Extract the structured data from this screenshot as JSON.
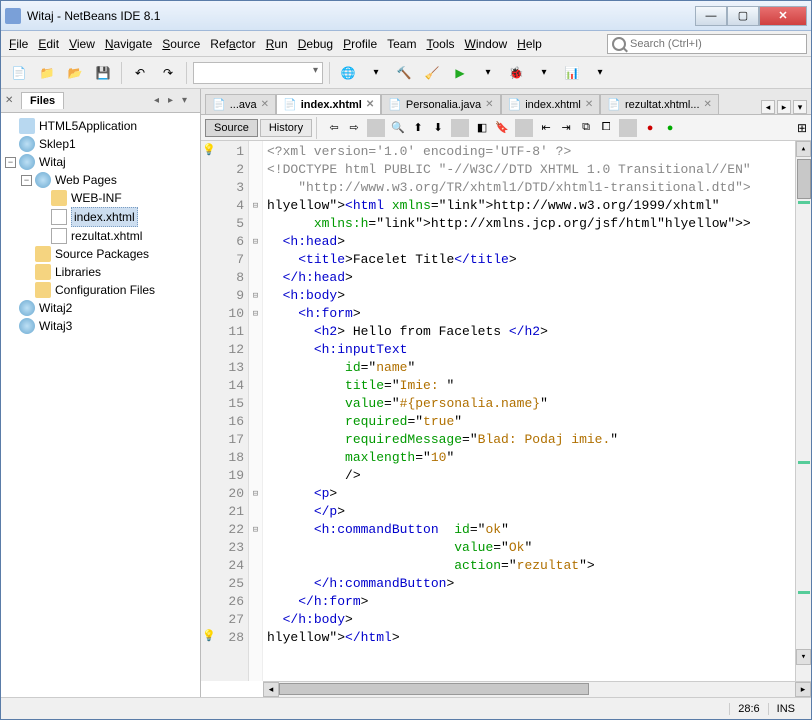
{
  "window": {
    "title": "Witaj - NetBeans IDE 8.1"
  },
  "menu": [
    "File",
    "Edit",
    "View",
    "Navigate",
    "Source",
    "Refactor",
    "Run",
    "Debug",
    "Profile",
    "Team",
    "Tools",
    "Window",
    "Help"
  ],
  "menuMnemonic": [
    "F",
    "E",
    "V",
    "N",
    "S",
    "a",
    "R",
    "D",
    "P",
    "",
    "T",
    "W",
    "H"
  ],
  "search": {
    "placeholder": "Search (Ctrl+I)"
  },
  "filesTabLabel": "Files",
  "projects": [
    {
      "name": "HTML5Application",
      "open": false,
      "icon": "proj"
    },
    {
      "name": "Sklep1",
      "open": false,
      "icon": "globe"
    },
    {
      "name": "Witaj",
      "open": true,
      "icon": "globe",
      "children": [
        {
          "name": "Web Pages",
          "open": true,
          "icon": "globe",
          "children": [
            {
              "name": "WEB-INF",
              "open": false,
              "icon": "folder"
            },
            {
              "name": "index.xhtml",
              "open": false,
              "icon": "file",
              "selected": true
            },
            {
              "name": "rezultat.xhtml",
              "open": false,
              "icon": "file"
            }
          ]
        },
        {
          "name": "Source Packages",
          "open": false,
          "icon": "folder"
        },
        {
          "name": "Libraries",
          "open": false,
          "icon": "folder"
        },
        {
          "name": "Configuration Files",
          "open": false,
          "icon": "folder"
        }
      ]
    },
    {
      "name": "Witaj2",
      "open": false,
      "icon": "globe"
    },
    {
      "name": "Witaj3",
      "open": false,
      "icon": "globe"
    }
  ],
  "editorTabs": [
    {
      "label": "...ava",
      "active": false
    },
    {
      "label": "index.xhtml",
      "active": true
    },
    {
      "label": "Personalia.java",
      "active": false
    },
    {
      "label": "index.xhtml",
      "active": false
    },
    {
      "label": "rezultat.xhtml...",
      "active": false
    }
  ],
  "sourceLabel": "Source",
  "historyLabel": "History",
  "code": {
    "lines": [
      "<?xml version='1.0' encoding='UTF-8' ?>",
      "<!DOCTYPE html PUBLIC \"-//W3C//DTD XHTML 1.0 Transitional//EN\"",
      "    \"http://www.w3.org/TR/xhtml1/DTD/xhtml1-transitional.dtd\">",
      "<html xmlns=\"http://www.w3.org/1999/xhtml\"",
      "      xmlns:h=\"http://xmlns.jcp.org/jsf/html\">",
      "  <h:head>",
      "    <title>Facelet Title</title>",
      "  </h:head>",
      "  <h:body>",
      "    <h:form>",
      "      <h2> Hello from Facelets </h2>",
      "      <h:inputText",
      "          id=\"name\"",
      "          title=\"Imie: \"",
      "          value=\"#{personalia.name}\"",
      "          required=\"true\"",
      "          requiredMessage=\"Blad: Podaj imie.\"",
      "          maxlength=\"10\"",
      "          />",
      "      <p>",
      "      </p>",
      "      <h:commandButton  id=\"ok\"",
      "                        value=\"Ok\"",
      "                        action=\"rezultat\">",
      "      </h:commandButton>",
      "    </h:form>",
      "  </h:body>",
      "</html>"
    ]
  },
  "status": {
    "pos": "28:6",
    "mode": "INS"
  }
}
